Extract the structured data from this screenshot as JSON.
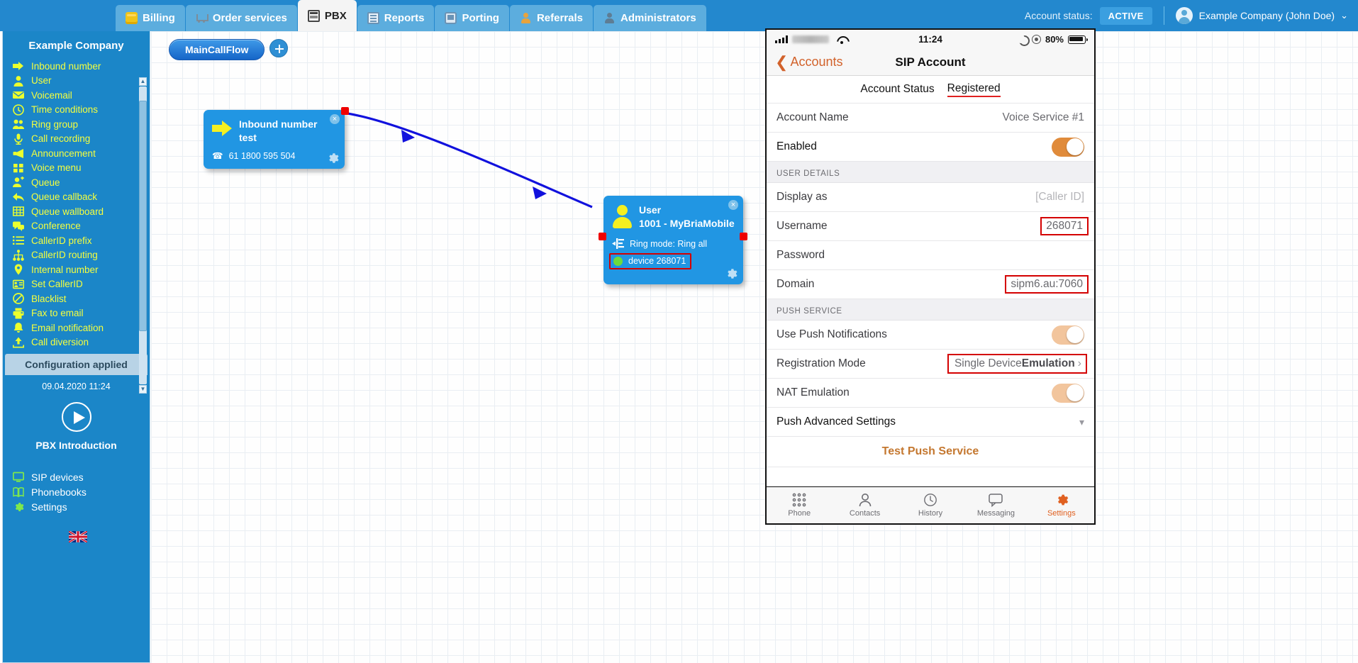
{
  "topnav": {
    "tabs": [
      {
        "label": "Billing",
        "icon": "coin-icon",
        "icon_class": "ico-billing",
        "active": false
      },
      {
        "label": "Order services",
        "icon": "cart-icon",
        "icon_class": "ico-cart",
        "active": false
      },
      {
        "label": "PBX",
        "icon": "pbx-icon",
        "icon_class": "ico-pbx",
        "active": true
      },
      {
        "label": "Reports",
        "icon": "reports-icon",
        "icon_class": "ico-reports",
        "active": false
      },
      {
        "label": "Porting",
        "icon": "porting-icon",
        "icon_class": "ico-porting",
        "active": false
      },
      {
        "label": "Referrals",
        "icon": "person-icon",
        "icon_class": "ico-person",
        "active": false
      },
      {
        "label": "Administrators",
        "icon": "admin-person-icon",
        "icon_class": "ico-person-dark",
        "active": false
      }
    ],
    "account_status_label": "Account status:",
    "account_status_value": "ACTIVE",
    "user_name": "Example Company (John Doe)",
    "user_caret": "⌄",
    "brand_blue": "#2388ce",
    "status_badge_color": "#3b9fe0"
  },
  "sidebar": {
    "title": "Example Company",
    "items": [
      {
        "label": "Inbound number",
        "icon": "arrow-right-icon"
      },
      {
        "label": "User",
        "icon": "user-icon"
      },
      {
        "label": "Voicemail",
        "icon": "envelope-icon"
      },
      {
        "label": "Time conditions",
        "icon": "clock-icon"
      },
      {
        "label": "Ring group",
        "icon": "users-group-icon"
      },
      {
        "label": "Call recording",
        "icon": "microphone-icon"
      },
      {
        "label": "Announcement",
        "icon": "megaphone-icon"
      },
      {
        "label": "Voice menu",
        "icon": "grid-squares-icon"
      },
      {
        "label": "Queue",
        "icon": "user-plus-icon"
      },
      {
        "label": "Queue callback",
        "icon": "reply-arrow-icon"
      },
      {
        "label": "Queue wallboard",
        "icon": "table-icon"
      },
      {
        "label": "Conference",
        "icon": "chat-bubbles-icon"
      },
      {
        "label": "CallerID prefix",
        "icon": "list-icon"
      },
      {
        "label": "CallerID routing",
        "icon": "sitemap-icon"
      },
      {
        "label": "Internal number",
        "icon": "map-pin-icon"
      },
      {
        "label": "Set CallerID",
        "icon": "id-card-icon"
      },
      {
        "label": "Blacklist",
        "icon": "ban-icon"
      },
      {
        "label": "Fax to email",
        "icon": "fax-icon"
      },
      {
        "label": "Email notification",
        "icon": "bell-icon"
      },
      {
        "label": "Call diversion",
        "icon": "upload-arrow-icon"
      }
    ],
    "config_applied": "Configuration applied",
    "config_timestamp": "09.04.2020 11:24",
    "intro_label": "PBX Introduction",
    "bottom_items": [
      {
        "label": "SIP devices",
        "icon": "monitor-icon"
      },
      {
        "label": "Phonebooks",
        "icon": "book-icon"
      },
      {
        "label": "Settings",
        "icon": "gear-icon"
      }
    ],
    "language_flag": "uk-flag-icon",
    "bg_color": "#1b86c8",
    "link_color": "#f5ff3e"
  },
  "canvas": {
    "flow_name": "MainCallFlow",
    "add_button_icon": "plus-circle-icon",
    "nodes": [
      {
        "type": "inbound-number-node",
        "icon": "yellow-arrow-icon",
        "title": "Inbound number",
        "subtitle": "test",
        "detail_icon": "telephone-icon",
        "detail": "61 1800 595 504",
        "close_icon": "close-icon",
        "gear_icon": "gear-icon",
        "port_color": "#ee0000"
      },
      {
        "type": "user-node",
        "icon": "yellow-user-icon",
        "title": "User",
        "subtitle": "1001 - MyBriaMobile",
        "ring_mode_icon": "ring-mode-icon",
        "ring_mode": "Ring mode: Ring all",
        "device_status_icon": "green-dot-icon",
        "device": "device 268071",
        "device_highlighted": true,
        "close_icon": "close-icon",
        "gear_icon": "gear-icon",
        "port_color": "#ee0000"
      }
    ],
    "connector_color": "#1111dd"
  },
  "phone": {
    "status_bar": {
      "signal_icon": "signal-bars-icon",
      "carrier": "",
      "wifi_icon": "wifi-icon",
      "time": "11:24",
      "moon_icon": "do-not-disturb-moon-icon",
      "eye_icon": "eye-icon",
      "battery_percent": "80%",
      "battery_icon": "battery-icon"
    },
    "navbar": {
      "back_chevron": "❮",
      "back_label": "Accounts",
      "title": "SIP Account"
    },
    "account_status": {
      "label": "Account Status",
      "value": "Registered",
      "value_underlined_red": true
    },
    "rows_top": [
      {
        "label": "Account Name",
        "value": "Voice Service #1",
        "kind": "value"
      },
      {
        "label": "Enabled",
        "value": "",
        "kind": "toggle",
        "toggle_state": "on"
      }
    ],
    "user_details_header": "USER DETAILS",
    "user_details_rows": [
      {
        "label": "Display as",
        "value": "[Caller ID]",
        "kind": "placeholder"
      },
      {
        "label": "Username",
        "value": "268071",
        "kind": "value",
        "highlighted": true
      },
      {
        "label": "Password",
        "value": "",
        "kind": "value"
      },
      {
        "label": "Domain",
        "value": "sipm6.au:7060",
        "kind": "value",
        "highlighted": true
      }
    ],
    "push_service_header": "PUSH SERVICE",
    "push_rows": [
      {
        "label": "Use Push Notifications",
        "value": "",
        "kind": "toggle",
        "toggle_state": "on-light"
      },
      {
        "label": "Registration Mode",
        "value": "Single Device",
        "value_bold": "Emulation",
        "kind": "chevron",
        "highlighted": true
      },
      {
        "label": "NAT Emulation",
        "value": "",
        "kind": "toggle",
        "toggle_state": "on-light"
      },
      {
        "label": "Push Advanced Settings",
        "value": "",
        "kind": "expand"
      }
    ],
    "test_push_label": "Test Push Service",
    "tabbar": [
      {
        "label": "Phone",
        "icon": "keypad-icon",
        "active": false
      },
      {
        "label": "Contacts",
        "icon": "contacts-person-icon",
        "active": false
      },
      {
        "label": "History",
        "icon": "clock-icon",
        "active": false
      },
      {
        "label": "Messaging",
        "icon": "chat-bubble-icon",
        "active": false
      },
      {
        "label": "Settings",
        "icon": "gear-icon",
        "active": true
      }
    ],
    "accent_color": "#e06020",
    "highlight_color": "#d40000"
  }
}
